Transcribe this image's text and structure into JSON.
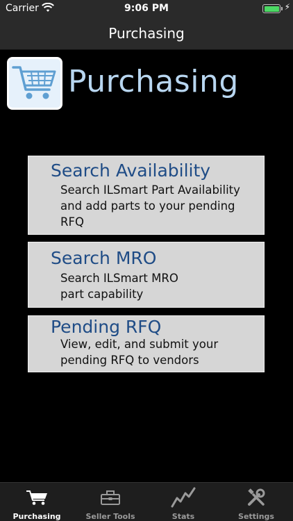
{
  "status": {
    "carrier": "Carrier",
    "time": "9:06 PM",
    "battery_level": 1.0
  },
  "nav": {
    "title": "Purchasing"
  },
  "header": {
    "title": "Purchasing",
    "icon": "shopping-cart-icon"
  },
  "menu": [
    {
      "title": "Search Availability",
      "description": "Search ILSmart Part Availability\nand add parts to your pending\nRFQ"
    },
    {
      "title": "Search MRO",
      "description": "Search ILSmart MRO\npart capability"
    },
    {
      "title": "Pending RFQ",
      "description": "View, edit, and submit your\npending RFQ to vendors"
    }
  ],
  "tabs": [
    {
      "label": "Purchasing",
      "icon": "cart-icon",
      "active": true
    },
    {
      "label": "Seller Tools",
      "icon": "toolbox-icon",
      "active": false
    },
    {
      "label": "Stats",
      "icon": "stats-chart-icon",
      "active": false
    },
    {
      "label": "Settings",
      "icon": "tools-icon",
      "active": false
    }
  ],
  "colors": {
    "background": "#000000",
    "bar": "#2a2a2a",
    "card": "#d6d6d6",
    "card_title": "#1f4c86",
    "header_text": "#b8d6f0",
    "battery": "#4cd964"
  }
}
